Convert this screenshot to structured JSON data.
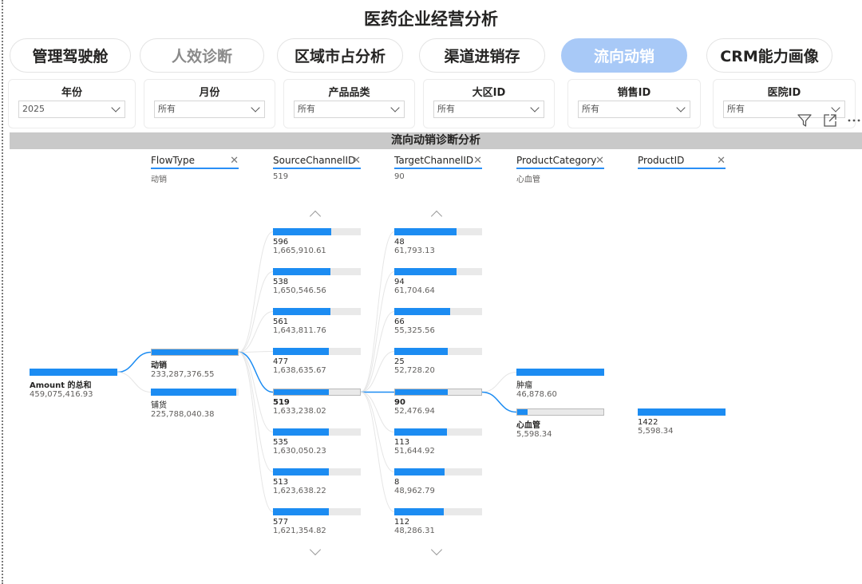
{
  "page_title": "医药企业经营分析",
  "nav": [
    {
      "label": "管理驾驶舱",
      "state": "normal"
    },
    {
      "label": "人效诊断",
      "state": "dim"
    },
    {
      "label": "区域市占分析",
      "state": "normal"
    },
    {
      "label": "渠道进销存",
      "state": "normal"
    },
    {
      "label": "流向动销",
      "state": "active"
    },
    {
      "label": "CRM能力画像",
      "state": "normal"
    }
  ],
  "slicers": [
    {
      "label": "年份",
      "value": "2025"
    },
    {
      "label": "月份",
      "value": "所有"
    },
    {
      "label": "产品品类",
      "value": "所有"
    },
    {
      "label": "大区ID",
      "value": "所有"
    },
    {
      "label": "销售ID",
      "value": "所有"
    },
    {
      "label": "医院ID",
      "value": "所有"
    }
  ],
  "toolbar_icons": [
    "filter-icon",
    "focus-mode-icon",
    "more-options-icon"
  ],
  "visual_title": "流向动销诊断分析",
  "columns": [
    {
      "name": "FlowType",
      "selected": "动销"
    },
    {
      "name": "SourceChannelID",
      "selected": "519"
    },
    {
      "name": "TargetChannelID",
      "selected": "90"
    },
    {
      "name": "ProductCategory",
      "selected": "心血管"
    },
    {
      "name": "ProductID",
      "selected": ""
    }
  ],
  "accent_color": "#1c8cf2",
  "active_nav_color": "#a8c9f7",
  "tree": {
    "root": {
      "label": "Amount 的总和",
      "value": "459,075,416.93",
      "fill": 1.0
    },
    "flowtype": [
      {
        "label": "动销",
        "value": "233,287,376.55",
        "fill": 1.0,
        "selected": true
      },
      {
        "label": "铺货",
        "value": "225,788,040.38",
        "fill": 0.97,
        "selected": false
      }
    ],
    "source": [
      {
        "label": "596",
        "value": "1,665,910.61",
        "fill": 0.66,
        "selected": false
      },
      {
        "label": "538",
        "value": "1,650,546.56",
        "fill": 0.65,
        "selected": false
      },
      {
        "label": "561",
        "value": "1,643,811.76",
        "fill": 0.65,
        "selected": false
      },
      {
        "label": "477",
        "value": "1,638,635.67",
        "fill": 0.64,
        "selected": false
      },
      {
        "label": "519",
        "value": "1,633,238.02",
        "fill": 0.64,
        "selected": true
      },
      {
        "label": "535",
        "value": "1,630,050.23",
        "fill": 0.64,
        "selected": false
      },
      {
        "label": "513",
        "value": "1,623,638.22",
        "fill": 0.64,
        "selected": false
      },
      {
        "label": "577",
        "value": "1,621,354.82",
        "fill": 0.64,
        "selected": false
      }
    ],
    "target": [
      {
        "label": "48",
        "value": "61,793.13",
        "fill": 0.71,
        "selected": false
      },
      {
        "label": "94",
        "value": "61,704.64",
        "fill": 0.71,
        "selected": false
      },
      {
        "label": "66",
        "value": "55,325.56",
        "fill": 0.64,
        "selected": false
      },
      {
        "label": "25",
        "value": "52,728.20",
        "fill": 0.61,
        "selected": false
      },
      {
        "label": "90",
        "value": "52,476.94",
        "fill": 0.61,
        "selected": true
      },
      {
        "label": "113",
        "value": "51,644.92",
        "fill": 0.6,
        "selected": false
      },
      {
        "label": "8",
        "value": "48,962.79",
        "fill": 0.57,
        "selected": false
      },
      {
        "label": "112",
        "value": "48,286.31",
        "fill": 0.56,
        "selected": false
      }
    ],
    "category": [
      {
        "label": "肿瘤",
        "value": "46,878.60",
        "fill": 1.0,
        "selected": false
      },
      {
        "label": "心血管",
        "value": "5,598.34",
        "fill": 0.12,
        "selected": true
      }
    ],
    "product": [
      {
        "label": "1422",
        "value": "5,598.34",
        "fill": 1.0,
        "selected": false
      }
    ]
  }
}
